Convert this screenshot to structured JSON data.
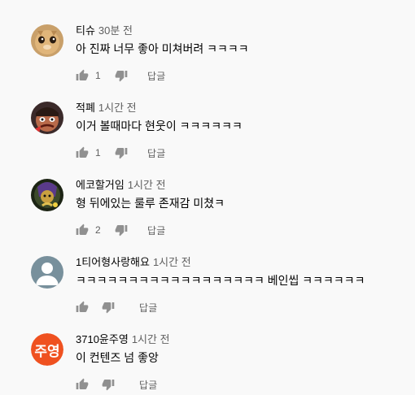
{
  "comments": [
    {
      "author": "티슈",
      "time": "30분 전",
      "text": "아 진짜 너무 좋아 미쳐버려 ㅋㅋㅋㅋ",
      "likes": "1",
      "reply": "답글",
      "avatar": "photo-cat"
    },
    {
      "author": "적폐",
      "time": "1시간 전",
      "text": "이거 볼때마다 현웃이 ㅋㅋㅋㅋㅋㅋ",
      "likes": "1",
      "reply": "답글",
      "avatar": "photo-cartoon"
    },
    {
      "author": "에코할거임",
      "time": "1시간 전",
      "text": "형 뒤에있는 룰루 존재감 미쳤ㅋ",
      "likes": "2",
      "reply": "답글",
      "avatar": "photo-game"
    },
    {
      "author": "1티어형사랑해요",
      "time": "1시간 전",
      "text": "ㅋㅋㅋㅋㅋㅋㅋㅋㅋㅋㅋㅋㅋㅋㅋㅋㅋㅋ 베인씹 ㅋㅋㅋㅋㅋㅋ",
      "likes": "",
      "reply": "답글",
      "avatar": "default-user"
    },
    {
      "author": "3710윤주영",
      "time": "1시간 전",
      "text": "이 컨텐즈 넘 좋앙",
      "likes": "",
      "reply": "답글",
      "avatar": "initial",
      "avatar_text": "주영",
      "avatar_color": "#ef5120"
    }
  ],
  "top_fragment": {
    "reply": "답글"
  }
}
